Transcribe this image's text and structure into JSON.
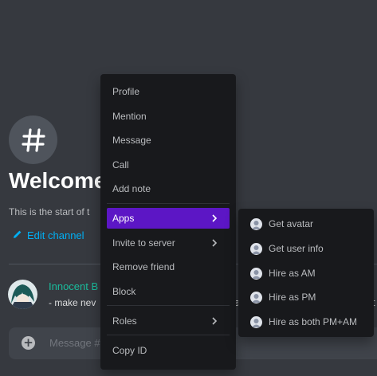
{
  "channel": {
    "welcome_title": "Welcome",
    "welcome_subtitle": "This is the start of t",
    "edit_channel_label": "Edit channel"
  },
  "message": {
    "author": "Innocent B",
    "body": "- make nev",
    "peek_a": "a",
    "peek_t": "t"
  },
  "composer": {
    "placeholder": "Message #"
  },
  "context_menu": {
    "items": [
      {
        "label": "Profile"
      },
      {
        "label": "Mention"
      },
      {
        "label": "Message"
      },
      {
        "label": "Call"
      },
      {
        "label": "Add note"
      },
      {
        "label": "Apps",
        "active": true,
        "submenu": true
      },
      {
        "label": "Invite to server",
        "submenu": true
      },
      {
        "label": "Remove friend"
      },
      {
        "label": "Block"
      },
      {
        "label": "Roles",
        "submenu": true
      },
      {
        "label": "Copy ID"
      }
    ]
  },
  "apps_submenu": {
    "items": [
      {
        "label": "Get avatar"
      },
      {
        "label": "Get user info"
      },
      {
        "label": "Hire as AM"
      },
      {
        "label": "Hire as PM"
      },
      {
        "label": "Hire as both PM+AM"
      }
    ]
  },
  "colors": {
    "accent_active": "#5c16c5",
    "link": "#00aff4",
    "username": "#1abc9c"
  }
}
